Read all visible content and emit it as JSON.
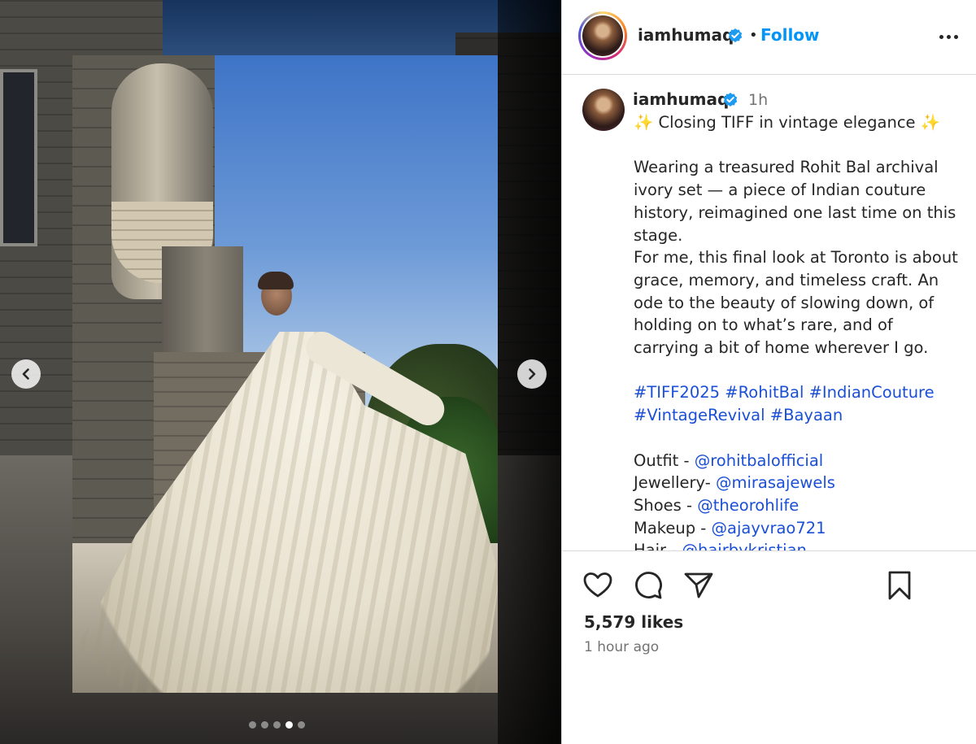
{
  "post": {
    "author": "iamhumaq",
    "follow_label": "Follow",
    "follow_separator": "•",
    "caption_time": "1h",
    "caption_lines": {
      "line1": "Closing TIFF in vintage elegance",
      "para1": "Wearing a treasured Rohit Bal archival ivory set — a piece of Indian couture history, reimagined one last time on this stage.",
      "para2": "For me, this final look at Toronto is about grace, memory, and timeless craft. An ode to the beauty of slowing down, of holding on to what’s rare, and of carrying a bit of home wherever I go."
    },
    "hashtags": [
      "#TIFF2025",
      "#RohitBal",
      "#IndianCouture",
      "#VintageRevival",
      "#Bayaan"
    ],
    "credits": [
      {
        "label": "Outfit - ",
        "handle": "@rohitbalofficial"
      },
      {
        "label": "Jewellery- ",
        "handle": "@mirasajewels"
      },
      {
        "label": "Shoes - ",
        "handle": "@theorohlife"
      },
      {
        "label": "Makeup - ",
        "handle": "@ajayvrao721"
      },
      {
        "label": "Hair - ",
        "handle": "@hairbykristian"
      }
    ],
    "sparkle": "✨",
    "likes": "5,579 likes",
    "posted_ago": "1 hour ago"
  },
  "carousel": {
    "slide_count": 5,
    "active_index": 3
  },
  "icons": {
    "verified": "verified-badge-icon",
    "more": "more-options-icon",
    "prev": "chevron-left-icon",
    "next": "chevron-right-icon",
    "like": "heart-icon",
    "comment": "comment-icon",
    "share": "send-icon",
    "save": "bookmark-icon"
  },
  "colors": {
    "accent": "#0095f6",
    "link": "#1a4fd6",
    "text": "#262626",
    "muted": "#737373",
    "verified": "#1d9bf0"
  }
}
